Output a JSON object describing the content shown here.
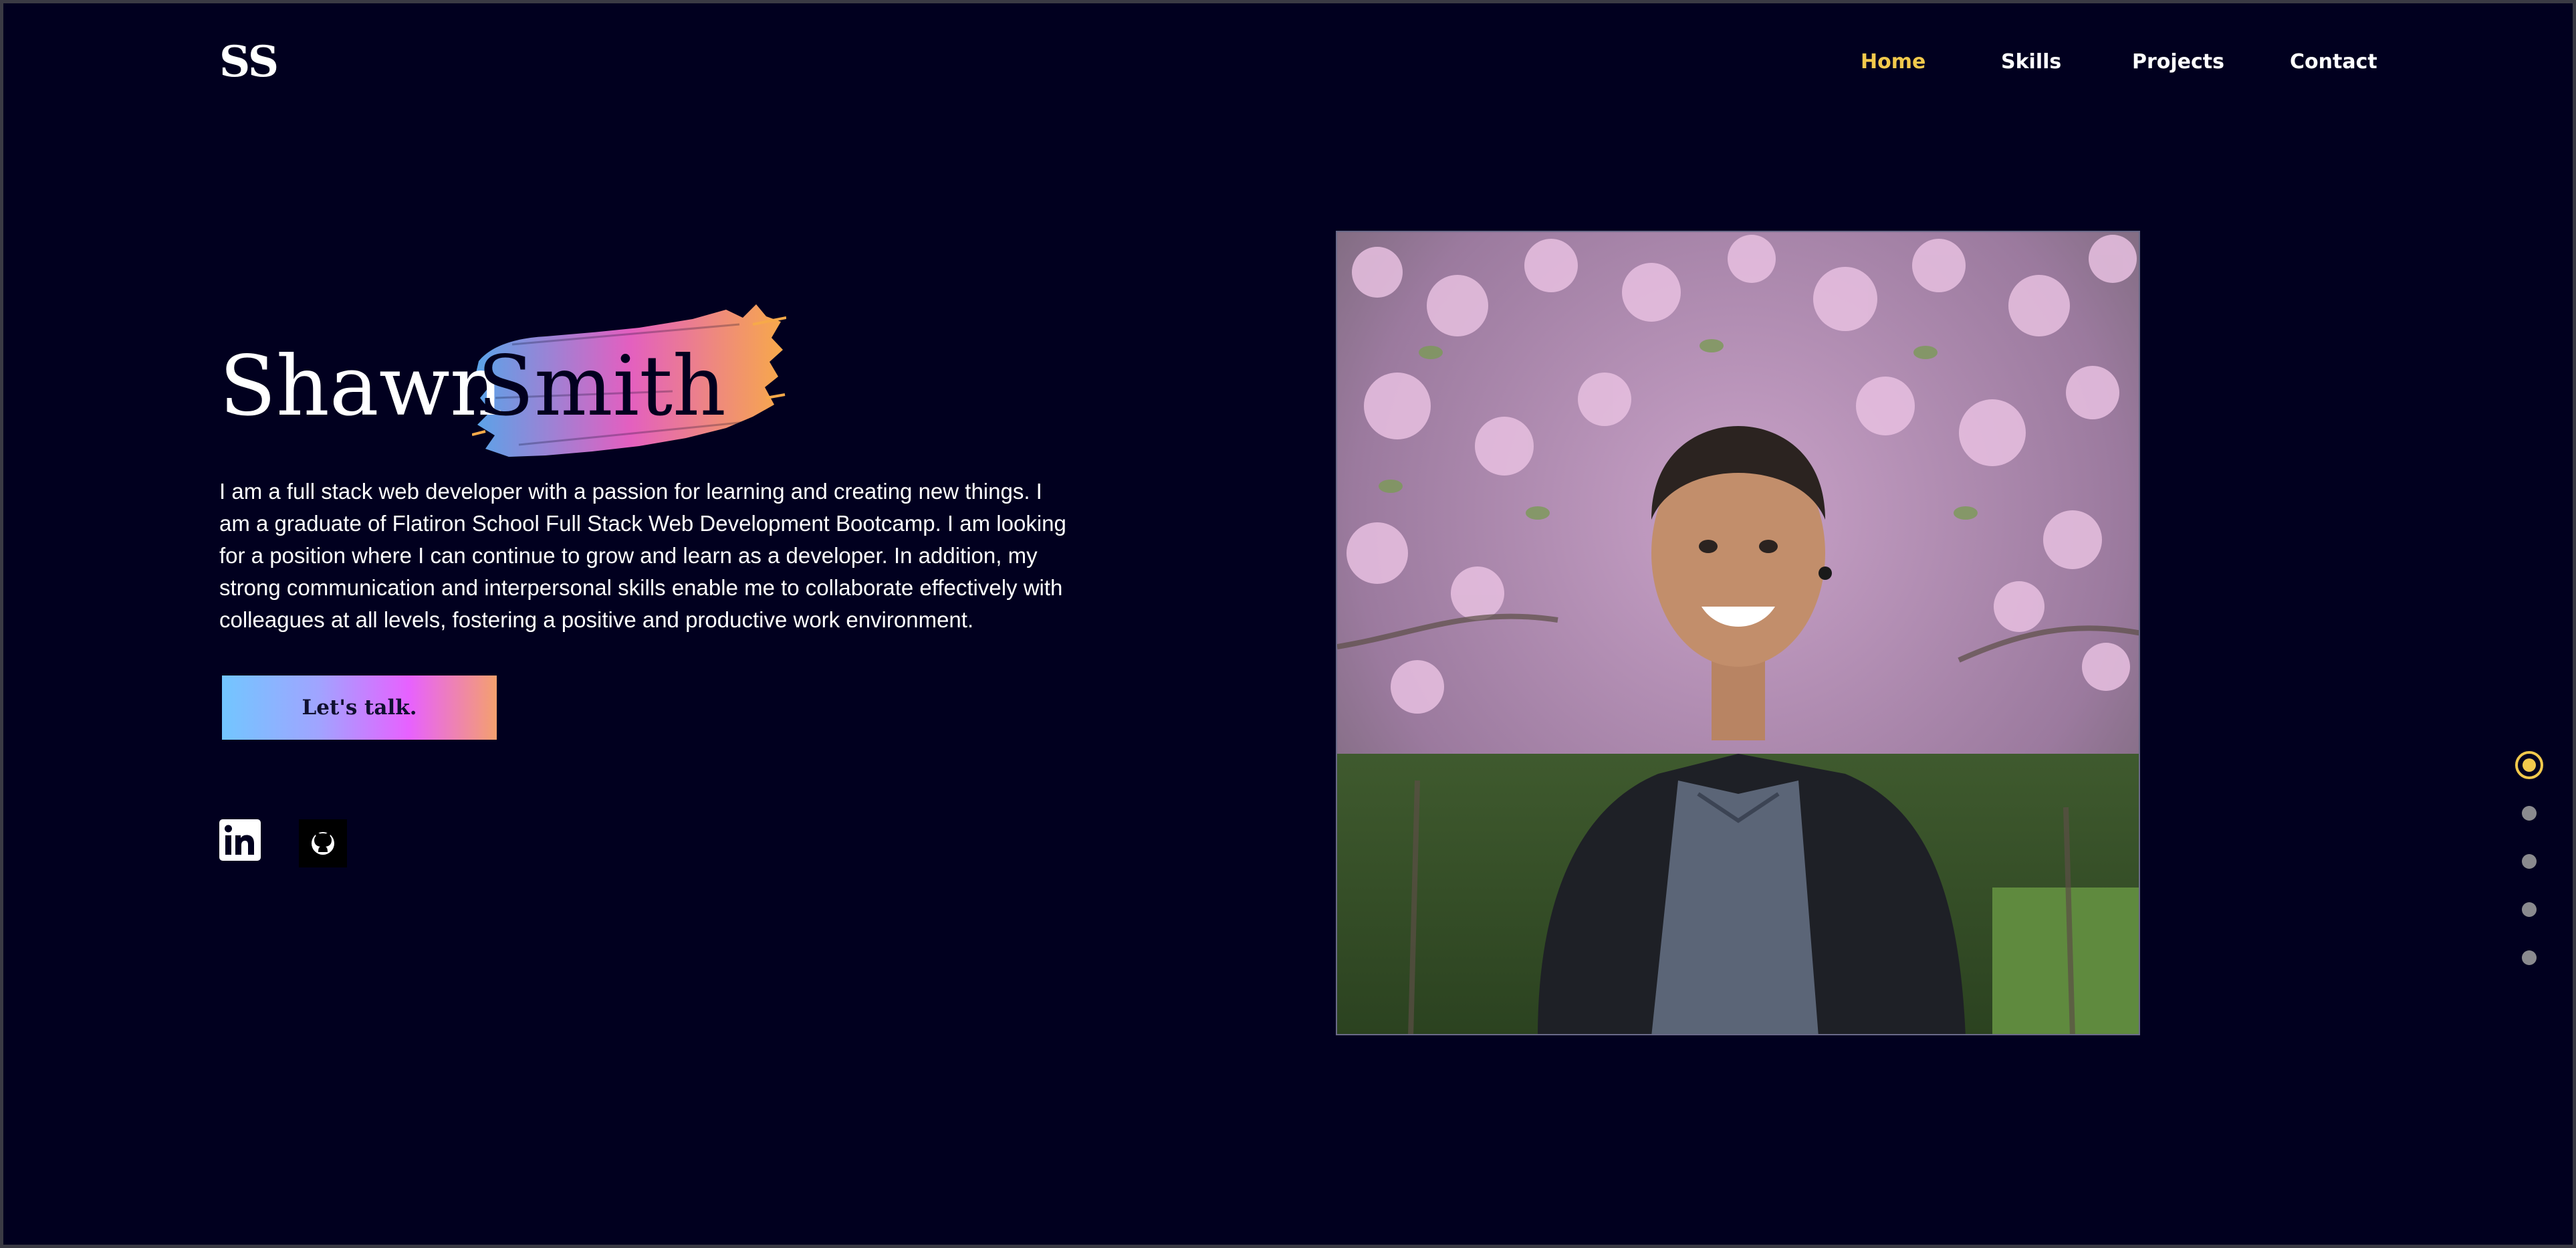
{
  "header": {
    "logo": "SS",
    "nav": [
      {
        "label": "Home",
        "active": true
      },
      {
        "label": "Skills",
        "active": false
      },
      {
        "label": "Projects",
        "active": false
      },
      {
        "label": "Contact",
        "active": false
      }
    ]
  },
  "hero": {
    "first_name": "Shawn",
    "last_name": "Smith",
    "bio": "I am a full stack web developer with a passion for learning and creating new things. I am a graduate of Flatiron School Full Stack Web Development Bootcamp. I am looking for a position where I can continue to grow and learn as a developer. In addition, my strong communication and interpersonal skills enable me to collaborate effectively with colleagues at all levels, fostering a positive and productive work environment.",
    "cta_label": "Let's talk.",
    "socials": [
      {
        "icon": "linkedin-icon"
      },
      {
        "icon": "github-icon"
      }
    ]
  },
  "section_dots": {
    "count": 5,
    "active_index": 0
  },
  "colors": {
    "background": "#01001f",
    "accent": "#f2c94c",
    "text": "#ffffff",
    "gradient": [
      "#72c6ff",
      "#e761ff",
      "#f4a06e"
    ]
  }
}
